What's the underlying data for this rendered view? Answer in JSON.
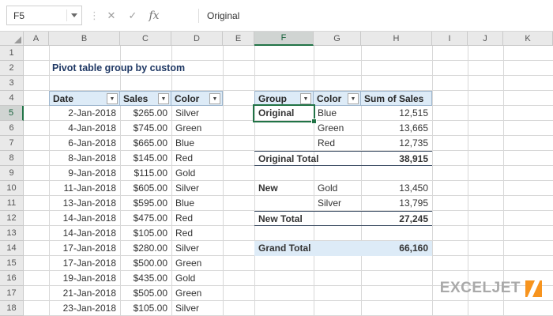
{
  "formula_bar": {
    "name_box": "F5",
    "formula": "Original",
    "fx_label": "fx"
  },
  "icons": {
    "dropdown": "▼",
    "cancel": "✕",
    "enter": "✓",
    "dots": "⋮"
  },
  "sheet": {
    "columns": [
      "A",
      "B",
      "C",
      "D",
      "E",
      "F",
      "G",
      "H",
      "I",
      "J",
      "K"
    ],
    "rows": [
      "1",
      "2",
      "3",
      "4",
      "5",
      "6",
      "7",
      "8",
      "9",
      "10",
      "11",
      "12",
      "13",
      "14",
      "15",
      "16",
      "17",
      "18"
    ],
    "selected_cell": "F5"
  },
  "title": "Pivot table group by custom",
  "source_table": {
    "headers": [
      "Date",
      "Sales",
      "Color"
    ],
    "rows": [
      [
        "2-Jan-2018",
        "$265.00",
        "Silver"
      ],
      [
        "4-Jan-2018",
        "$745.00",
        "Green"
      ],
      [
        "6-Jan-2018",
        "$665.00",
        "Blue"
      ],
      [
        "8-Jan-2018",
        "$145.00",
        "Red"
      ],
      [
        "9-Jan-2018",
        "$115.00",
        "Gold"
      ],
      [
        "11-Jan-2018",
        "$605.00",
        "Silver"
      ],
      [
        "13-Jan-2018",
        "$595.00",
        "Blue"
      ],
      [
        "14-Jan-2018",
        "$475.00",
        "Red"
      ],
      [
        "14-Jan-2018",
        "$105.00",
        "Red"
      ],
      [
        "17-Jan-2018",
        "$280.00",
        "Silver"
      ],
      [
        "17-Jan-2018",
        "$500.00",
        "Green"
      ],
      [
        "19-Jan-2018",
        "$435.00",
        "Gold"
      ],
      [
        "21-Jan-2018",
        "$505.00",
        "Green"
      ],
      [
        "23-Jan-2018",
        "$105.00",
        "Silver"
      ]
    ]
  },
  "pivot_table": {
    "headers": [
      "Group",
      "Color",
      "Sum of Sales"
    ],
    "rows": [
      {
        "group": "Original",
        "color": "Blue",
        "value": "12,515"
      },
      {
        "group": "",
        "color": "Green",
        "value": "13,665"
      },
      {
        "group": "",
        "color": "Red",
        "value": "12,735"
      },
      {
        "group": "Original Total",
        "color": "",
        "value": "38,915"
      },
      {
        "group": "",
        "color": "",
        "value": ""
      },
      {
        "group": "New",
        "color": "Gold",
        "value": "13,450"
      },
      {
        "group": "",
        "color": "Silver",
        "value": "13,795"
      },
      {
        "group": "New Total",
        "color": "",
        "value": "27,245"
      },
      {
        "group": "",
        "color": "",
        "value": ""
      },
      {
        "group": "Grand Total",
        "color": "",
        "value": "66,160"
      }
    ]
  },
  "logo": {
    "text": "EXCELJET"
  },
  "colors": {
    "accent_green": "#217346",
    "header_fill": "#DDEBF7",
    "title_navy": "#1F3864",
    "total_line": "#44546A",
    "logo_orange": "#F7941E",
    "logo_gray": "#A9A9A9"
  }
}
